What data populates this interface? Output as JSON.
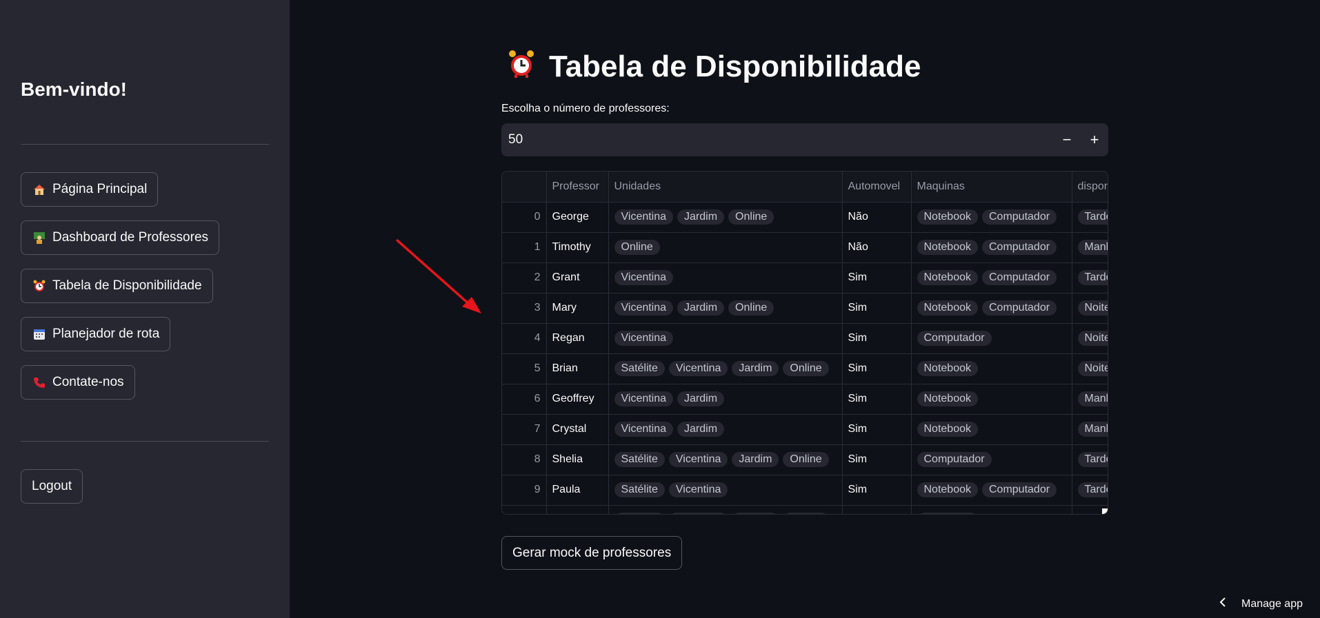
{
  "sidebar": {
    "welcome": "Bem-vindo!",
    "nav": [
      {
        "icon": "house-icon",
        "label": "Página Principal"
      },
      {
        "icon": "teacher-icon",
        "label": "Dashboard de Professores"
      },
      {
        "icon": "alarm-clock-icon",
        "label": "Tabela de Disponibilidade"
      },
      {
        "icon": "calendar-icon",
        "label": "Planejador de rota"
      },
      {
        "icon": "phone-icon",
        "label": "Contate-nos"
      }
    ],
    "logout_label": "Logout"
  },
  "main": {
    "title": "Tabela de Disponibilidade",
    "number_label": "Escolha o número de professores:",
    "number_value": "50",
    "minus": "−",
    "plus": "+",
    "generate_button": "Gerar mock de professores"
  },
  "table": {
    "columns": [
      "",
      "Professor",
      "Unidades",
      "Automovel",
      "Maquinas",
      "dispon"
    ],
    "rows": [
      {
        "idx": "0",
        "professor": "George",
        "unidades": [
          "Vicentina",
          "Jardim",
          "Online"
        ],
        "automovel": "Não",
        "maquinas": [
          "Notebook",
          "Computador"
        ],
        "dispon": "Tarde"
      },
      {
        "idx": "1",
        "professor": "Timothy",
        "unidades": [
          "Online"
        ],
        "automovel": "Não",
        "maquinas": [
          "Notebook",
          "Computador"
        ],
        "dispon": "Manh"
      },
      {
        "idx": "2",
        "professor": "Grant",
        "unidades": [
          "Vicentina"
        ],
        "automovel": "Sim",
        "maquinas": [
          "Notebook",
          "Computador"
        ],
        "dispon": "Tarde"
      },
      {
        "idx": "3",
        "professor": "Mary",
        "unidades": [
          "Vicentina",
          "Jardim",
          "Online"
        ],
        "automovel": "Sim",
        "maquinas": [
          "Notebook",
          "Computador"
        ],
        "dispon": "Noite"
      },
      {
        "idx": "4",
        "professor": "Regan",
        "unidades": [
          "Vicentina"
        ],
        "automovel": "Sim",
        "maquinas": [
          "Computador"
        ],
        "dispon": "Noite"
      },
      {
        "idx": "5",
        "professor": "Brian",
        "unidades": [
          "Satélite",
          "Vicentina",
          "Jardim",
          "Online"
        ],
        "automovel": "Sim",
        "maquinas": [
          "Notebook"
        ],
        "dispon": "Noite"
      },
      {
        "idx": "6",
        "professor": "Geoffrey",
        "unidades": [
          "Vicentina",
          "Jardim"
        ],
        "automovel": "Sim",
        "maquinas": [
          "Notebook"
        ],
        "dispon": "Manh"
      },
      {
        "idx": "7",
        "professor": "Crystal",
        "unidades": [
          "Vicentina",
          "Jardim"
        ],
        "automovel": "Sim",
        "maquinas": [
          "Notebook"
        ],
        "dispon": "Manh"
      },
      {
        "idx": "8",
        "professor": "Shelia",
        "unidades": [
          "Satélite",
          "Vicentina",
          "Jardim",
          "Online"
        ],
        "automovel": "Sim",
        "maquinas": [
          "Computador"
        ],
        "dispon": "Tarde"
      },
      {
        "idx": "9",
        "professor": "Paula",
        "unidades": [
          "Satélite",
          "Vicentina"
        ],
        "automovel": "Sim",
        "maquinas": [
          "Notebook",
          "Computador"
        ],
        "dispon": "Tarde"
      },
      {
        "idx": "",
        "professor": "",
        "unidades": [
          "Satélite",
          "Vicentina",
          "Jardim",
          "Online"
        ],
        "automovel": "",
        "maquinas": [
          "Notebook"
        ],
        "dispon": ""
      }
    ]
  },
  "footer": {
    "manage_app": "Manage app"
  },
  "colors": {
    "background": "#0e1117",
    "sidebar": "#262730",
    "annotation_arrow": "#e8141b"
  }
}
